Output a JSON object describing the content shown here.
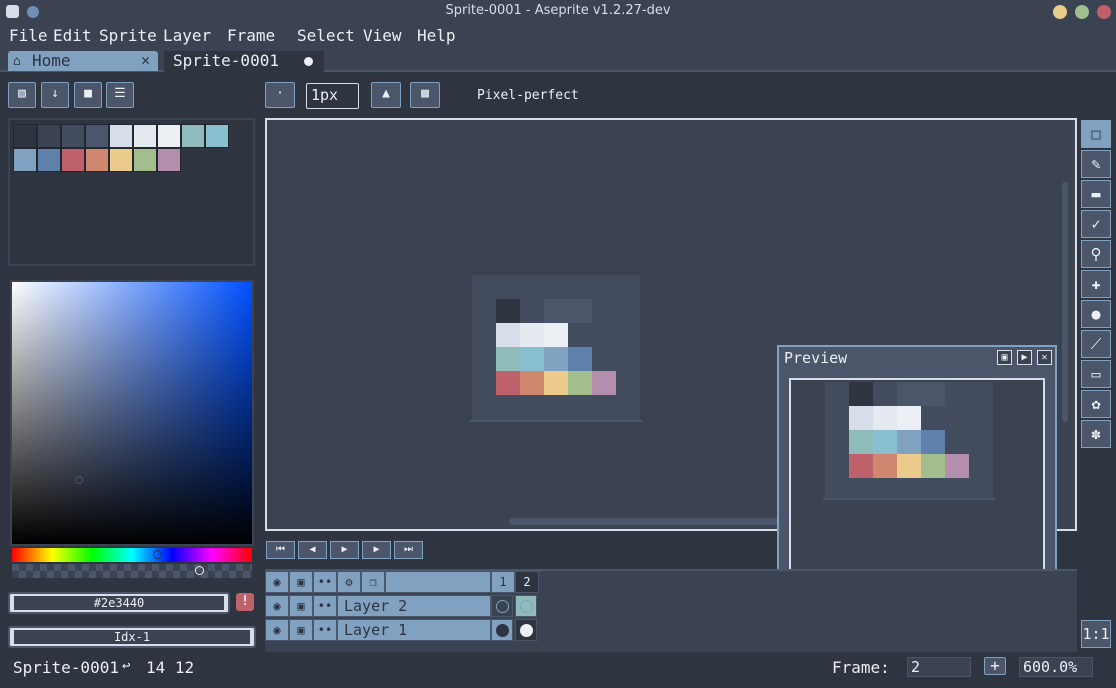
{
  "window": {
    "title": "Sprite-0001 - Aseprite v1.2.27-dev"
  },
  "menu": [
    "File",
    "Edit",
    "Sprite",
    "Layer",
    "Frame",
    "Select",
    "View",
    "Help"
  ],
  "tabs": {
    "home": "Home",
    "sprite": "Sprite-0001"
  },
  "context_bar": {
    "brush_size": "1px",
    "pixel_perfect_label": "Pixel-perfect"
  },
  "palette": [
    "#2e3440",
    "#3b4252",
    "#434c5e",
    "#4c566a",
    "#d8dee9",
    "#e5e9f0",
    "#eceff4",
    "#8fbcbb",
    "#88c0d0",
    "#81a1c1",
    "#5e81ac",
    "#bf616a",
    "#d08770",
    "#ebcb8b",
    "#a3be8c",
    "#b48ead"
  ],
  "color": {
    "hex": "#2e3440",
    "index": "Idx-1",
    "warning": "!"
  },
  "preview": {
    "title": "Preview"
  },
  "timeline": {
    "frames": [
      "1",
      "2"
    ],
    "layers": [
      {
        "name": "Layer 2"
      },
      {
        "name": "Layer 1"
      }
    ]
  },
  "status": {
    "sprite_name": "Sprite-0001",
    "size": "14 12",
    "frame_label": "Frame:",
    "frame_value": "2",
    "zoom": "600.0%",
    "zoom_reset": "1:1"
  },
  "icons": {
    "lock": "lock-icon",
    "download": "download-icon",
    "sort": "sort-icon",
    "menu": "menu-icon",
    "eye": "eye-icon",
    "padlock": "padlock-icon"
  }
}
